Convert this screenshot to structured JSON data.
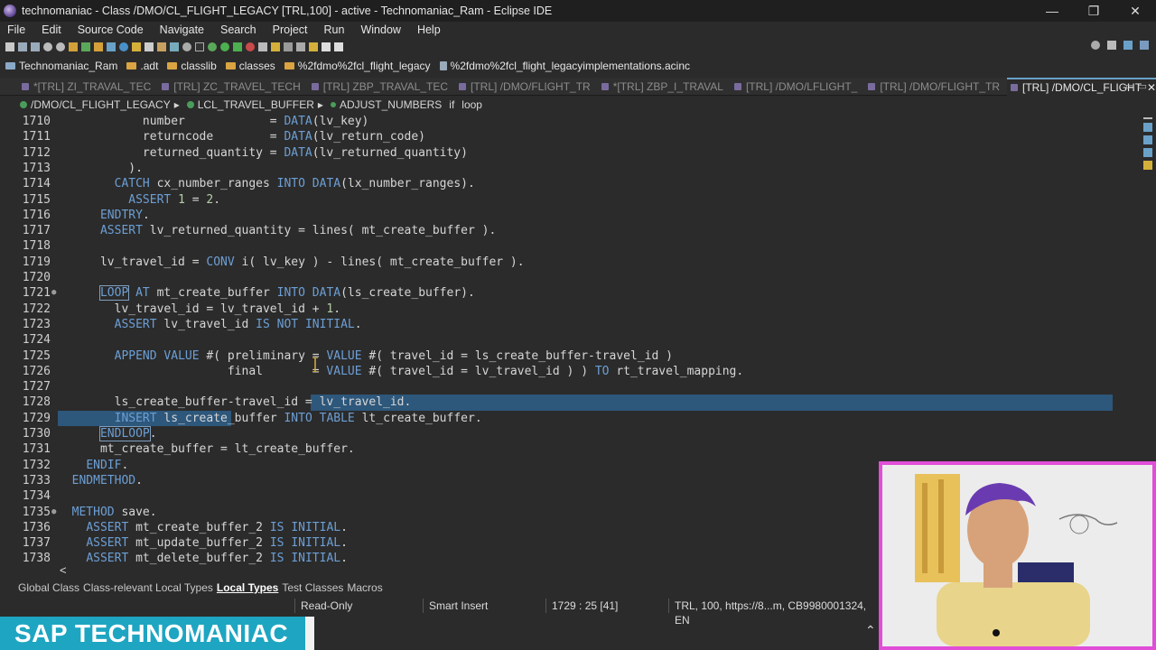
{
  "window": {
    "title": "technomaniac - Class /DMO/CL_FLIGHT_LEGACY [TRL,100] - active - Technomaniac_Ram - Eclipse IDE",
    "minimize": "—",
    "maximize": "❐",
    "close": "✕"
  },
  "menu": [
    "File",
    "Edit",
    "Source Code",
    "Navigate",
    "Search",
    "Project",
    "Run",
    "Window",
    "Help"
  ],
  "breadcrumb": [
    "Technomaniac_Ram",
    ".adt",
    "classlib",
    "classes",
    "%2fdmo%2fcl_flight_legacy",
    "%2fdmo%2fcl_flight_legacyimplementations.acinc"
  ],
  "tabs": [
    {
      "label": "*[TRL] ZI_TRAVAL_TEC",
      "active": false
    },
    {
      "label": "[TRL] ZC_TRAVEL_TECH",
      "active": false
    },
    {
      "label": "[TRL] ZBP_TRAVAL_TEC",
      "active": false
    },
    {
      "label": "[TRL] /DMO/FLIGHT_TR",
      "active": false
    },
    {
      "label": "*[TRL] ZBP_I_TRAVAL",
      "active": false
    },
    {
      "label": "[TRL] /DMO/LFLIGHT_",
      "active": false
    },
    {
      "label": "[TRL] /DMO/FLIGHT_TR",
      "active": false
    },
    {
      "label": "[TRL] /DMO/CL_FLIGHT",
      "active": true
    }
  ],
  "editor_path": [
    "/DMO/CL_FLIGHT_LEGACY",
    "LCL_TRAVEL_BUFFER",
    "ADJUST_NUMBERS",
    "if",
    "loop"
  ],
  "code_lines": [
    {
      "n": "1710",
      "t": "            number            = DATA(lv_key)"
    },
    {
      "n": "1711",
      "t": "            returncode        = DATA(lv_return_code)"
    },
    {
      "n": "1712",
      "t": "            returned_quantity = DATA(lv_returned_quantity)"
    },
    {
      "n": "1713",
      "t": "          )."
    },
    {
      "n": "1714",
      "t": "        CATCH cx_number_ranges INTO DATA(lx_number_ranges)."
    },
    {
      "n": "1715",
      "t": "          ASSERT 1 = 2."
    },
    {
      "n": "1716",
      "t": "      ENDTRY."
    },
    {
      "n": "1717",
      "t": "      ASSERT lv_returned_quantity = lines( mt_create_buffer )."
    },
    {
      "n": "1718",
      "t": ""
    },
    {
      "n": "1719",
      "t": "      lv_travel_id = CONV i( lv_key ) - lines( mt_create_buffer )."
    },
    {
      "n": "1720",
      "t": ""
    },
    {
      "n": "1721",
      "t": "      LOOP AT mt_create_buffer INTO DATA(ls_create_buffer).",
      "fold": true
    },
    {
      "n": "1722",
      "t": "        lv_travel_id = lv_travel_id + 1."
    },
    {
      "n": "1723",
      "t": "        ASSERT lv_travel_id IS NOT INITIAL."
    },
    {
      "n": "1724",
      "t": ""
    },
    {
      "n": "1725",
      "t": "        APPEND VALUE #( preliminary = VALUE #( travel_id = ls_create_buffer-travel_id )"
    },
    {
      "n": "1726",
      "t": "                        final       = VALUE #( travel_id = lv_travel_id ) ) TO rt_travel_mapping."
    },
    {
      "n": "1727",
      "t": ""
    },
    {
      "n": "1728",
      "t": "        ls_create_buffer-travel_id = lv_travel_id."
    },
    {
      "n": "1729",
      "t": "        INSERT ls_create_buffer INTO TABLE lt_create_buffer."
    },
    {
      "n": "1730",
      "t": "      ENDLOOP."
    },
    {
      "n": "1731",
      "t": "      mt_create_buffer = lt_create_buffer."
    },
    {
      "n": "1732",
      "t": "    ENDIF."
    },
    {
      "n": "1733",
      "t": "  ENDMETHOD."
    },
    {
      "n": "1734",
      "t": ""
    },
    {
      "n": "1735",
      "t": "  METHOD save.",
      "fold": true
    },
    {
      "n": "1736",
      "t": "    ASSERT mt_create_buffer_2 IS INITIAL."
    },
    {
      "n": "1737",
      "t": "    ASSERT mt_update_buffer_2 IS INITIAL."
    },
    {
      "n": "1738",
      "t": "    ASSERT mt_delete_buffer_2 IS INITIAL."
    }
  ],
  "bottom_tabs": [
    "Global Class",
    "Class-relevant Local Types",
    "Local Types",
    "Test Classes",
    "Macros"
  ],
  "bottom_tab_active": "Local Types",
  "hscroll_left": "<",
  "status": {
    "mode": "Read-Only",
    "insert": "Smart Insert",
    "position": "1729 : 25 [41]",
    "system": "TRL, 100, https://8...m, CB9980001324, EN"
  },
  "banner": "SAP TECHNOMANIAC",
  "accent": "#1ea5c2",
  "cam_border": "#e04ed8"
}
